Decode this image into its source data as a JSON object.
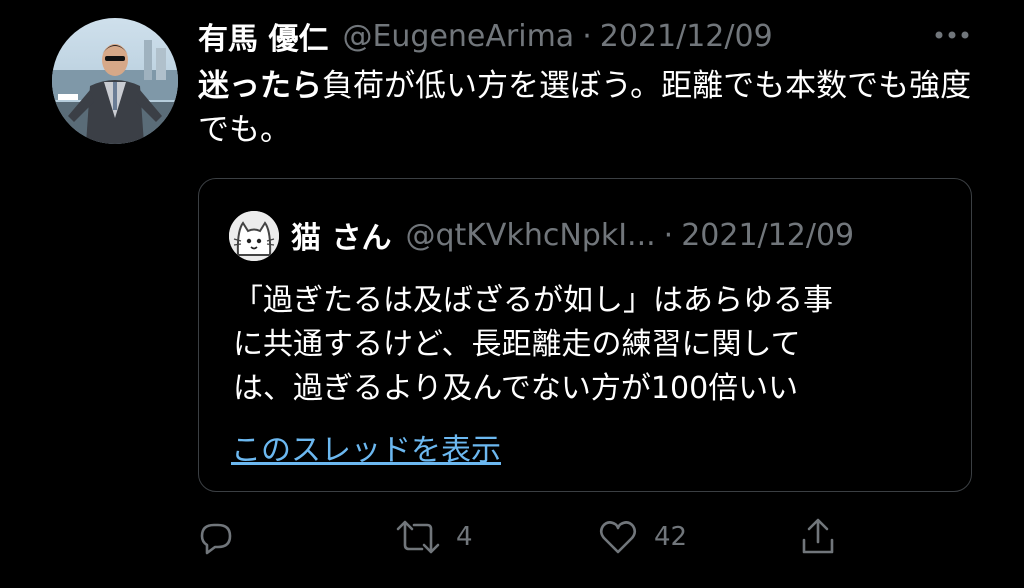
{
  "author": {
    "name": "有馬 優仁",
    "handle": "@EugeneArima",
    "separator": "·",
    "date": "2021/12/09"
  },
  "tweet": {
    "text_bold": "迷ったら",
    "text_rest": "負荷が低い方を選ぼう。距離でも本数でも強度でも。"
  },
  "quote": {
    "name": "猫 さん",
    "handle": "@qtKVkhcNpkI...",
    "separator": "·",
    "date": "2021/12/09",
    "text_line1": "「過ぎたるは及ばざるが如し」はあらゆる事",
    "text_line2": "に共通するけど、長距離走の練習に関して",
    "text_line3": "は、過ぎるより及んでない方が100倍いい",
    "thread_link": "このスレッドを表示"
  },
  "actions": {
    "reply_icon": "reply-icon",
    "retweet_icon": "retweet-icon",
    "retweet_count": "4",
    "like_icon": "heart-icon",
    "like_count": "42",
    "share_icon": "share-icon"
  },
  "colors": {
    "background": "#000000",
    "text": "#ffffff",
    "secondary": "#71767b",
    "link": "#6cb8f0",
    "border": "#3b3f43"
  }
}
